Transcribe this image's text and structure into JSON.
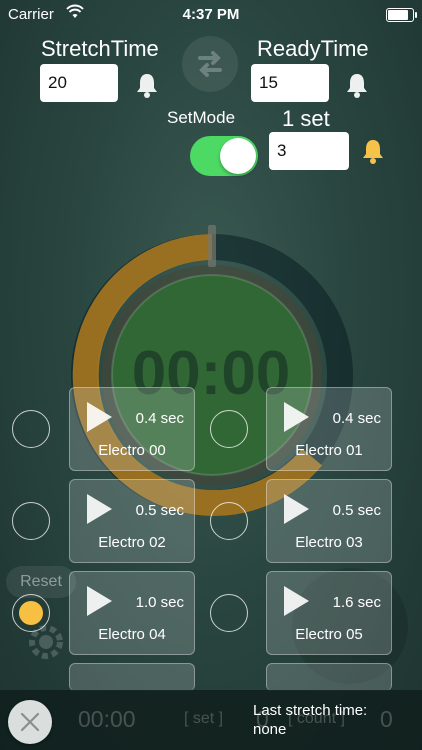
{
  "status": {
    "carrier": "Carrier",
    "time": "4:37 PM",
    "battery_level": 0.9
  },
  "stretch": {
    "label": "StretchTime",
    "value": "20"
  },
  "ready": {
    "label": "ReadyTime",
    "value": "15"
  },
  "setmode": {
    "label": "SetMode",
    "on": true
  },
  "set": {
    "label": "1 set",
    "value": "3"
  },
  "timer": {
    "display": "00:00"
  },
  "electros": [
    {
      "name": "Electro 00",
      "duration": "0.4 sec",
      "selected": false
    },
    {
      "name": "Electro 01",
      "duration": "0.4 sec",
      "selected": false
    },
    {
      "name": "Electro 02",
      "duration": "0.5 sec",
      "selected": false
    },
    {
      "name": "Electro 03",
      "duration": "0.5 sec",
      "selected": false
    },
    {
      "name": "Electro 04",
      "duration": "1.0 sec",
      "selected": true
    },
    {
      "name": "Electro 05",
      "duration": "1.6 sec",
      "selected": false
    }
  ],
  "background": {
    "reset_label": "Reset",
    "elapsed": "00:00",
    "set_label": "[ set ]",
    "set_count": "0",
    "count_label": "[ count ]",
    "count_value": "0"
  },
  "footer": {
    "last_label": "Last stretch time:",
    "last_value": "none"
  },
  "colors": {
    "accent_green": "#4cd964",
    "ring_orange": "#c98a1e",
    "selected_yellow": "#f7c043",
    "bell": "#f5c24a"
  }
}
